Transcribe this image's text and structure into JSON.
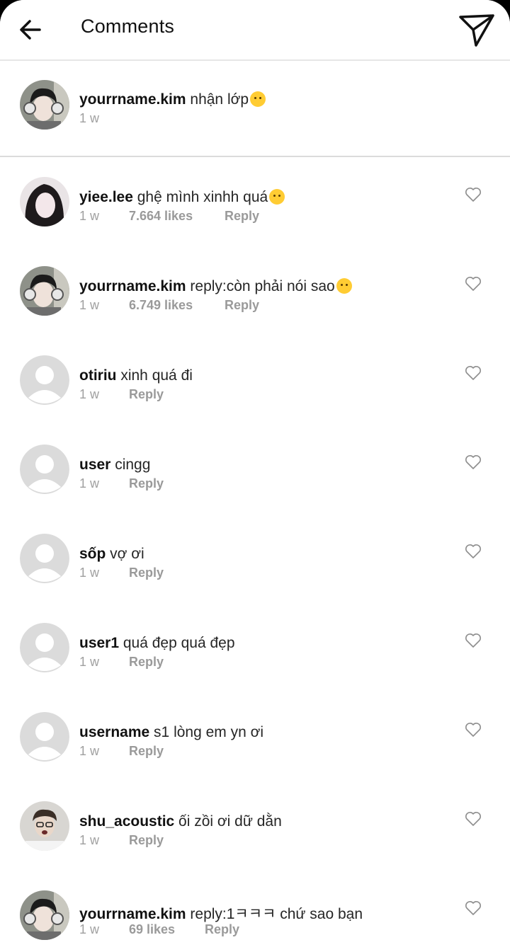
{
  "header": {
    "title": "Comments"
  },
  "caption": {
    "username": "yourrname.kim",
    "text": " nhận lớp",
    "emoji": "kissing-heart-emoji",
    "time": "1 w"
  },
  "comments": [
    {
      "username": "yiee.lee",
      "text": " ghệ mình xinhh quá",
      "emoji": "woozy-face-emoji",
      "time": "1 w",
      "likes": "7.664 likes",
      "reply": "Reply",
      "avatar": "photo"
    },
    {
      "username": "yourrname.kim",
      "text": " reply:còn phải nói sao",
      "emoji": "kissing-face-emoji",
      "time": "1 w",
      "likes": "6.749 likes",
      "reply": "Reply",
      "avatar": "photo"
    },
    {
      "username": "otiriu",
      "text": " xinh quá đi",
      "time": "1 w",
      "reply": "Reply",
      "avatar": "default"
    },
    {
      "username": "user",
      "text": " cingg",
      "time": "1 w",
      "reply": "Reply",
      "avatar": "default"
    },
    {
      "username": "sốp",
      "text": " vợ ơi",
      "time": "1 w",
      "reply": "Reply",
      "avatar": "default"
    },
    {
      "username": "user1",
      "text": " quá đẹp quá đẹp",
      "time": "1 w",
      "reply": "Reply",
      "avatar": "default"
    },
    {
      "username": "username",
      "text": " s1 lòng em yn ơi",
      "time": "1 w",
      "reply": "Reply",
      "avatar": "default"
    },
    {
      "username": "shu_acoustic",
      "text": " ối zồi ơi dữ dằn",
      "time": "1 w",
      "reply": "Reply",
      "avatar": "photo"
    },
    {
      "username": "yourrname.kim",
      "text": " reply:1ㅋㅋㅋ chứ sao bạn",
      "time": "1 w",
      "likes": "69 likes",
      "reply": "Reply",
      "avatar": "photo"
    }
  ],
  "colors": {
    "accent_text": "#262626",
    "meta_text": "#a0a0a0",
    "divider": "#dbdbdb"
  }
}
